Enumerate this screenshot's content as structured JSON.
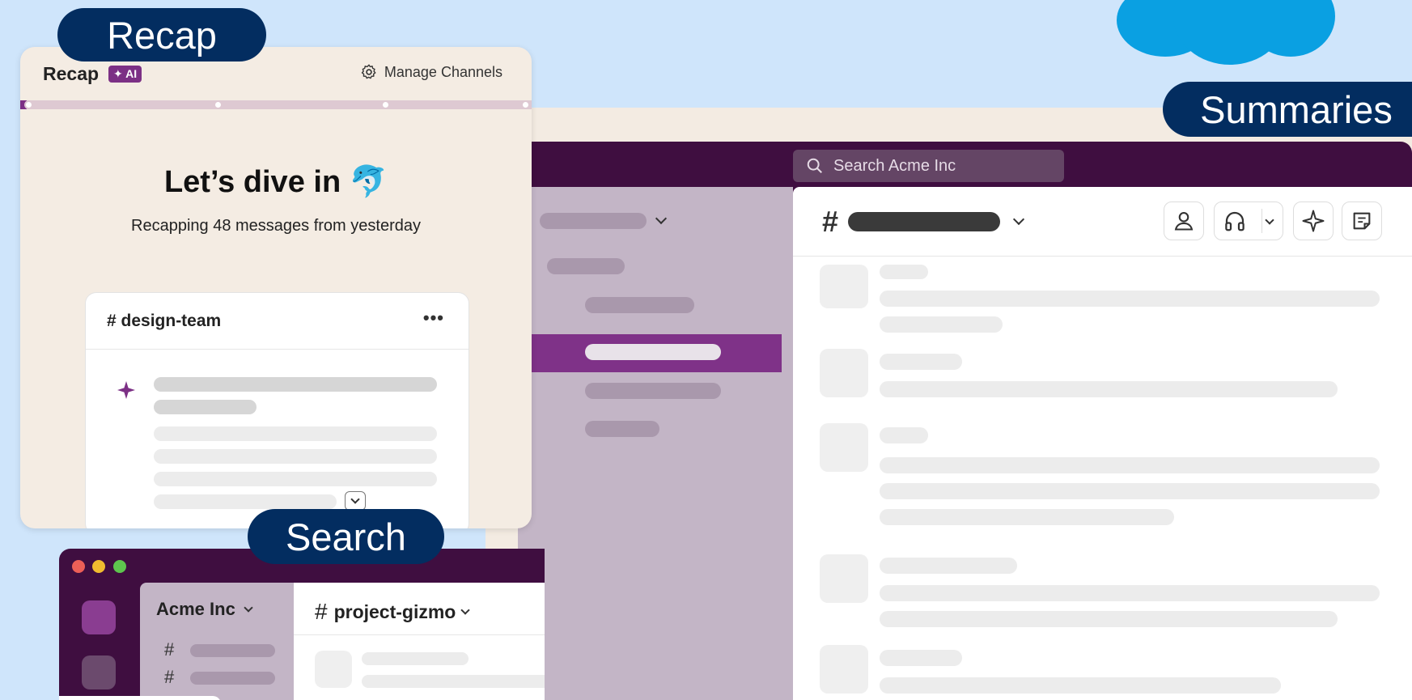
{
  "brand": {
    "cloud_color": "#0aa0e2",
    "label_bg": "#032d60",
    "slack_aubergine": "#3f0e40",
    "accent_purple": "#7c3085"
  },
  "labels": {
    "recap": "Recap",
    "summaries": "Summaries",
    "search": "Search"
  },
  "recap_panel": {
    "title": "Recap",
    "badge": "✦ AI",
    "manage_channels": "Manage Channels",
    "heading": "Let’s dive in 🐬",
    "subheading": "Recapping 48 messages from yesterday",
    "card": {
      "channel": "# design-team",
      "menu": "•••"
    }
  },
  "summaries_window": {
    "search_placeholder": "Search Acme Inc",
    "channel_hash": "#"
  },
  "search_window": {
    "workspace": "Acme Inc",
    "channel": "project-gizmo",
    "channel_hash": "#",
    "list_hash": "#"
  },
  "icons": [
    "search-icon",
    "gear-icon",
    "sparkle-icon",
    "member-icon",
    "headphones-icon",
    "chevron-down-icon",
    "canvas-icon",
    "more-icon"
  ]
}
